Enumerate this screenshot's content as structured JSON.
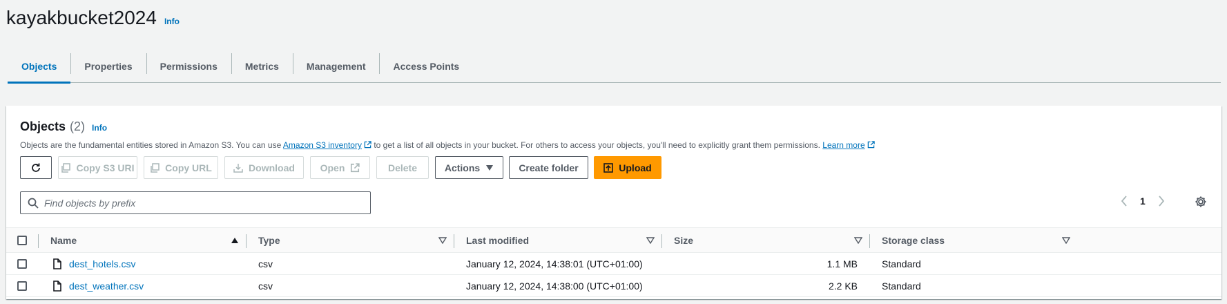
{
  "bucket": {
    "name": "kayakbucket2024",
    "info_label": "Info"
  },
  "tabs": [
    {
      "label": "Objects",
      "active": true
    },
    {
      "label": "Properties",
      "active": false
    },
    {
      "label": "Permissions",
      "active": false
    },
    {
      "label": "Metrics",
      "active": false
    },
    {
      "label": "Management",
      "active": false
    },
    {
      "label": "Access Points",
      "active": false
    }
  ],
  "objects_panel": {
    "title": "Objects",
    "count": "(2)",
    "info_label": "Info",
    "description_part1": "Objects are the fundamental entities stored in Amazon S3. You can use",
    "inventory_link": "Amazon S3 inventory",
    "description_part2": "to get a list of all objects in your bucket. For others to access your objects, you'll need to explicitly grant them permissions.",
    "learn_more": "Learn more"
  },
  "toolbar": {
    "copy_s3_uri": "Copy S3 URI",
    "copy_url": "Copy URL",
    "download": "Download",
    "open": "Open",
    "delete": "Delete",
    "actions": "Actions",
    "create_folder": "Create folder",
    "upload": "Upload"
  },
  "search": {
    "placeholder": "Find objects by prefix",
    "value": ""
  },
  "pagination": {
    "current_page": "1"
  },
  "table": {
    "columns": [
      "Name",
      "Type",
      "Last modified",
      "Size",
      "Storage class"
    ],
    "rows": [
      {
        "name": "dest_hotels.csv",
        "type": "csv",
        "last_modified": "January 12, 2024, 14:38:01 (UTC+01:00)",
        "size": "1.1 MB",
        "storage_class": "Standard"
      },
      {
        "name": "dest_weather.csv",
        "type": "csv",
        "last_modified": "January 12, 2024, 14:38:00 (UTC+01:00)",
        "size": "2.2 KB",
        "storage_class": "Standard"
      }
    ]
  },
  "colors": {
    "accent": "#0073bb",
    "upload": "#ff9900",
    "background": "#f2f3f3"
  }
}
